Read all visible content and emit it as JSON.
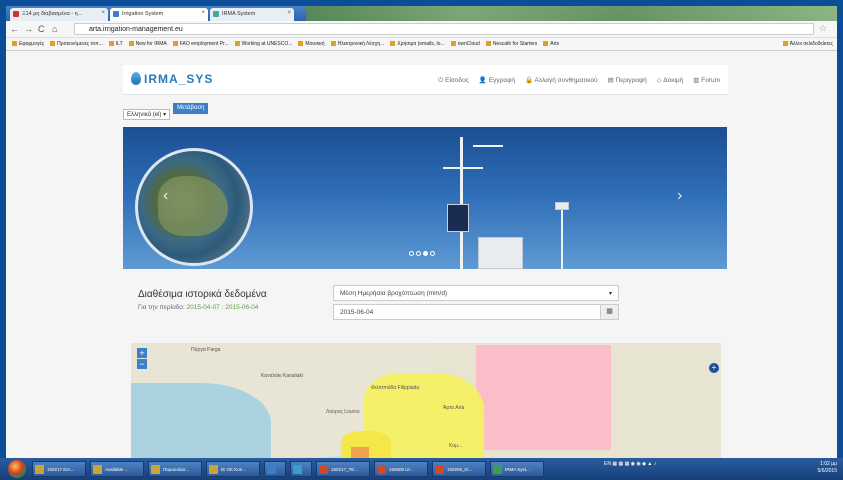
{
  "browser": {
    "tabs": [
      {
        "label": "Ξ14 μη διαβασμένα - η..."
      },
      {
        "label": "Irrigation System"
      },
      {
        "label": "IRMA System"
      }
    ],
    "url": "arta.irrigation-management.eu",
    "bookmarks": [
      "Εφαρμογές",
      "Προτεινόμενες τοπ...",
      "ILT",
      "New for IRMA",
      "FAO employment Pr...",
      "Working at UNESCO...",
      "Μουσική",
      "Ηλεκτρονική Λέσχη...",
      "Χρήσιμα (emails, lo...",
      "ownCloud",
      "Nescafé for Starters",
      "Arts",
      "Άλλοι σελιδοδείκτες"
    ]
  },
  "site": {
    "logo": "IRMA_SYS",
    "menu": [
      {
        "icon": "power-icon",
        "glyph": "⏻",
        "label": "Είσοδος"
      },
      {
        "icon": "user-icon",
        "glyph": "👤",
        "label": "Εγγραφή"
      },
      {
        "icon": "lock-icon",
        "glyph": "🔒",
        "label": "Αλλαγή συνθηματικού"
      },
      {
        "icon": "book-icon",
        "glyph": "▤",
        "label": "Περιγραφή"
      },
      {
        "icon": "eye-icon",
        "glyph": "◇",
        "label": "Δοκιμή"
      },
      {
        "icon": "forum-icon",
        "glyph": "▥",
        "label": "Forum"
      }
    ],
    "language": {
      "selected": "Ελληνικά (el)",
      "button": "Μετάβαση"
    },
    "carousel": {
      "slides": 4,
      "active": 2
    },
    "history": {
      "title": "Διαθέσιμα ιστορικά δεδομένα",
      "period_prefix": "Για την περίοδο:",
      "period_from": "2015-04-07",
      "period_sep": ":",
      "period_to": "2015-06-04",
      "variable": "Μέση Ημερήσια βροχόπτωση (mm/d)",
      "date": "2015-06-04"
    },
    "map": {
      "zoom_in": "+",
      "zoom_out": "−",
      "labels": [
        "Πάργα\nParga",
        "Καναλάκι\nKanaliaki",
        "Φιλιππιάδα\nFilippiada",
        "Λούρος\nLouros",
        "Άρτα\nArta",
        "Κομ..."
      ]
    }
  },
  "taskbar": {
    "items": [
      "150217 ΕΙΑ...",
      "Available ...",
      "Παρουσίασ...",
      "IE OK Kon...",
      "",
      "",
      "150217_TE...",
      "150605 Ur...",
      "150206_Ki...",
      "IRMA Syst..."
    ],
    "lang": "EN",
    "time": "1:02 μμ",
    "date": "5/6/2015"
  }
}
